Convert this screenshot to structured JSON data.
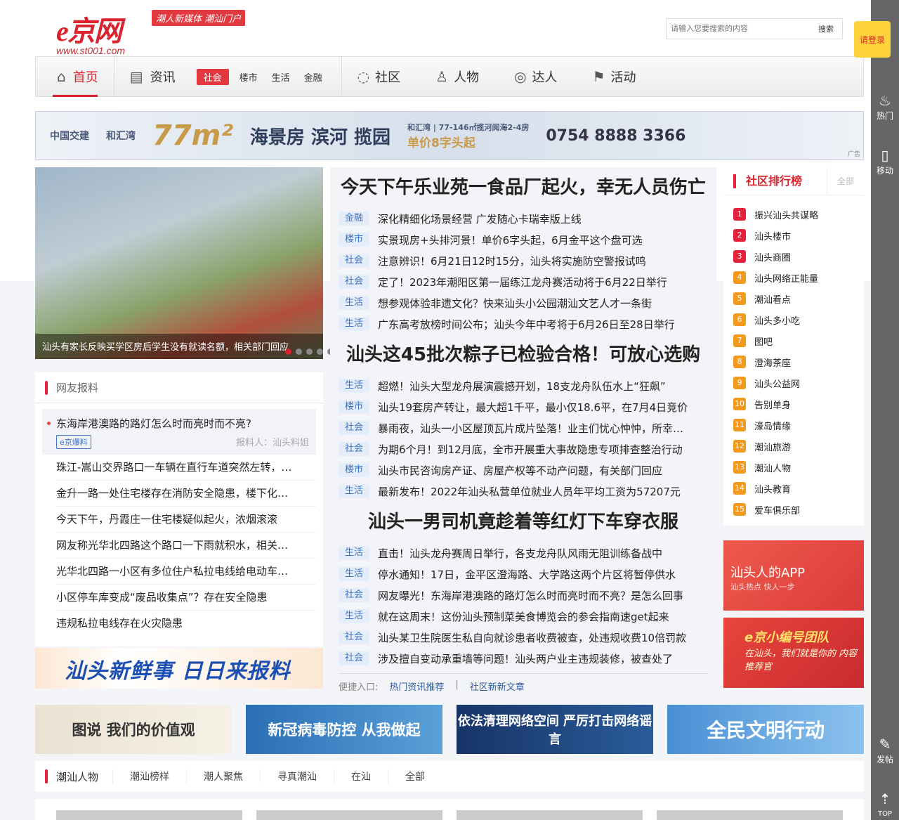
{
  "header": {
    "logo_text": "e京网",
    "logo_url": "www.st001.com",
    "slogan": "潮人新媒体 潮汕门户",
    "search_placeholder": "请输入您要搜索的内容",
    "search_button": "搜索",
    "login": "请登录"
  },
  "right_bar": {
    "hot": "热门",
    "mobile": "移动",
    "post": "发帖",
    "top": "TOP"
  },
  "nav": {
    "home": "首页",
    "news": "资讯",
    "news_sub": [
      "社会",
      "楼市",
      "生活",
      "金融"
    ],
    "community": "社区",
    "people": "人物",
    "expert": "达人",
    "activity": "活动"
  },
  "banner": {
    "brand1": "中国交建",
    "brand2": "和汇湾",
    "size": "77m²",
    "slogan": "海景房 滨河 揽园",
    "info": "和汇湾 | 77-146㎡揽河阅海2-4房",
    "price": "单价8字头起",
    "phone": "0754 8888 3366",
    "ad": "广告"
  },
  "slide": {
    "caption": "汕头有家长反映买学区房后学生没有就读名额，相关部门回应",
    "count": 5,
    "active": 1
  },
  "center": {
    "groups": [
      {
        "headline": "今天下午乐业苑一食品厂起火，幸无人员伤亡",
        "items": [
          {
            "tag": "金融",
            "text": "深化精细化场景经营 广发随心卡瑞幸版上线"
          },
          {
            "tag": "楼市",
            "text": "实景现房+头排河景！单价6字头起，6月金平这个盘可选"
          },
          {
            "tag": "社会",
            "text": "注意辨识！6月21日12时15分，汕头将实施防空警报试鸣"
          },
          {
            "tag": "社会",
            "text": "定了！2023年潮阳区第一届练江龙舟赛活动将于6月22日举行"
          },
          {
            "tag": "生活",
            "text": "想参观体验非遗文化？快来汕头小公园潮汕文艺人才一条街"
          },
          {
            "tag": "生活",
            "text": "广东高考放榜时间公布；汕头今年中考将于6月26日至28日举行"
          }
        ]
      },
      {
        "headline": "汕头这45批次粽子已检验合格！可放心选购",
        "items": [
          {
            "tag": "生活",
            "text": "超燃！汕头大型龙舟展演震撼开划，18支龙舟队伍水上“狂飙”"
          },
          {
            "tag": "楼市",
            "text": "汕头19套房产转让，最大超1千平，最小仅18.6平，在7月4日竞价"
          },
          {
            "tag": "社会",
            "text": "暴雨夜，汕头一小区屋顶瓦片成片坠落！业主们忧心忡忡，所幸…"
          },
          {
            "tag": "社会",
            "text": "为期6个月！到12月底，全市开展重大事故隐患专项排查整治行动"
          },
          {
            "tag": "楼市",
            "text": "汕头市民咨询房产证、房屋产权等不动产问题，有关部门回应"
          },
          {
            "tag": "生活",
            "text": "最新发布！2022年汕头私营单位就业人员年平均工资为57207元"
          }
        ]
      },
      {
        "headline": "汕头一男司机竟趁着等红灯下车穿衣服",
        "items": [
          {
            "tag": "生活",
            "text": "直击！汕头龙舟赛周日举行，各支龙舟队风雨无阻训练备战中"
          },
          {
            "tag": "生活",
            "text": "停水通知！17日，金平区澄海路、大学路这两个片区将暂停供水"
          },
          {
            "tag": "社会",
            "text": "网友曝光！东海岸港澳路的路灯怎么时而亮时而不亮？是怎么回事"
          },
          {
            "tag": "生活",
            "text": "就在这周末！这份汕头预制菜美食博览会的参会指南速get起来"
          },
          {
            "tag": "社会",
            "text": "汕头某卫生院医生私自向就诊患者收费被查，处违规收费10倍罚款"
          },
          {
            "tag": "社会",
            "text": "涉及擅自变动承重墙等问题！汕头两户业主违规装修，被查处了"
          }
        ]
      }
    ],
    "quick_label": "便捷入口:",
    "quick_links": [
      "热门资讯推荐",
      "社区新新文章"
    ]
  },
  "rank": {
    "title": "社区排行榜",
    "all": "全部",
    "items": [
      "振兴汕头共谋略",
      "汕头楼市",
      "汕头商圈",
      "汕头网络正能量",
      "潮汕看点",
      "汕头多小吃",
      "图吧",
      "澄海茶座",
      "汕头公益网",
      "告别单身",
      "濠岛情缘",
      "潮汕旅游",
      "潮汕人物",
      "汕头教育",
      "爱车俱乐部"
    ],
    "colors": {
      "top": "#e5203a",
      "rest": "#f39a1e"
    }
  },
  "app_promo": {
    "title": "汕头人的APP",
    "sub": "汕头热点 快人一步"
  },
  "editor_promo": {
    "title": "e京小编号团队",
    "sub": "在汕头，我们就是你的 内容推荐官"
  },
  "baoliao": {
    "title": "网友报料",
    "top": {
      "text": "东海岸港澳路的路灯怎么时而亮时而不亮?",
      "badge": "e京爆料",
      "reporter": "报料人：汕头料姐"
    },
    "items": [
      "珠江-嵩山交界路口一车辆在直行车道突然左转，…",
      "金升一路一处住宅楼存在消防安全隐患，楼下化…",
      "今天下午，丹霞庄一住宅楼疑似起火，浓烟滚滚",
      "网友称光华北四路这个路口一下雨就积水，相关…",
      "光华北四路一小区有多位住户私拉电线给电动车…",
      "小区停车库变成“废品收集点”？存在安全隐患",
      "违规私拉电线存在火灾隐患"
    ],
    "banner": "汕头新鲜事 日日来报料"
  },
  "ads": [
    "图说 我们的价值观",
    "新冠病毒防控 从我做起",
    "依法清理网络空间 严厉打击网络谣言",
    "全民文明行动"
  ],
  "people": {
    "title": "潮汕人物",
    "tabs": [
      "潮汕榜样",
      "潮人聚焦",
      "寻真潮汕",
      "在汕",
      "全部"
    ]
  }
}
